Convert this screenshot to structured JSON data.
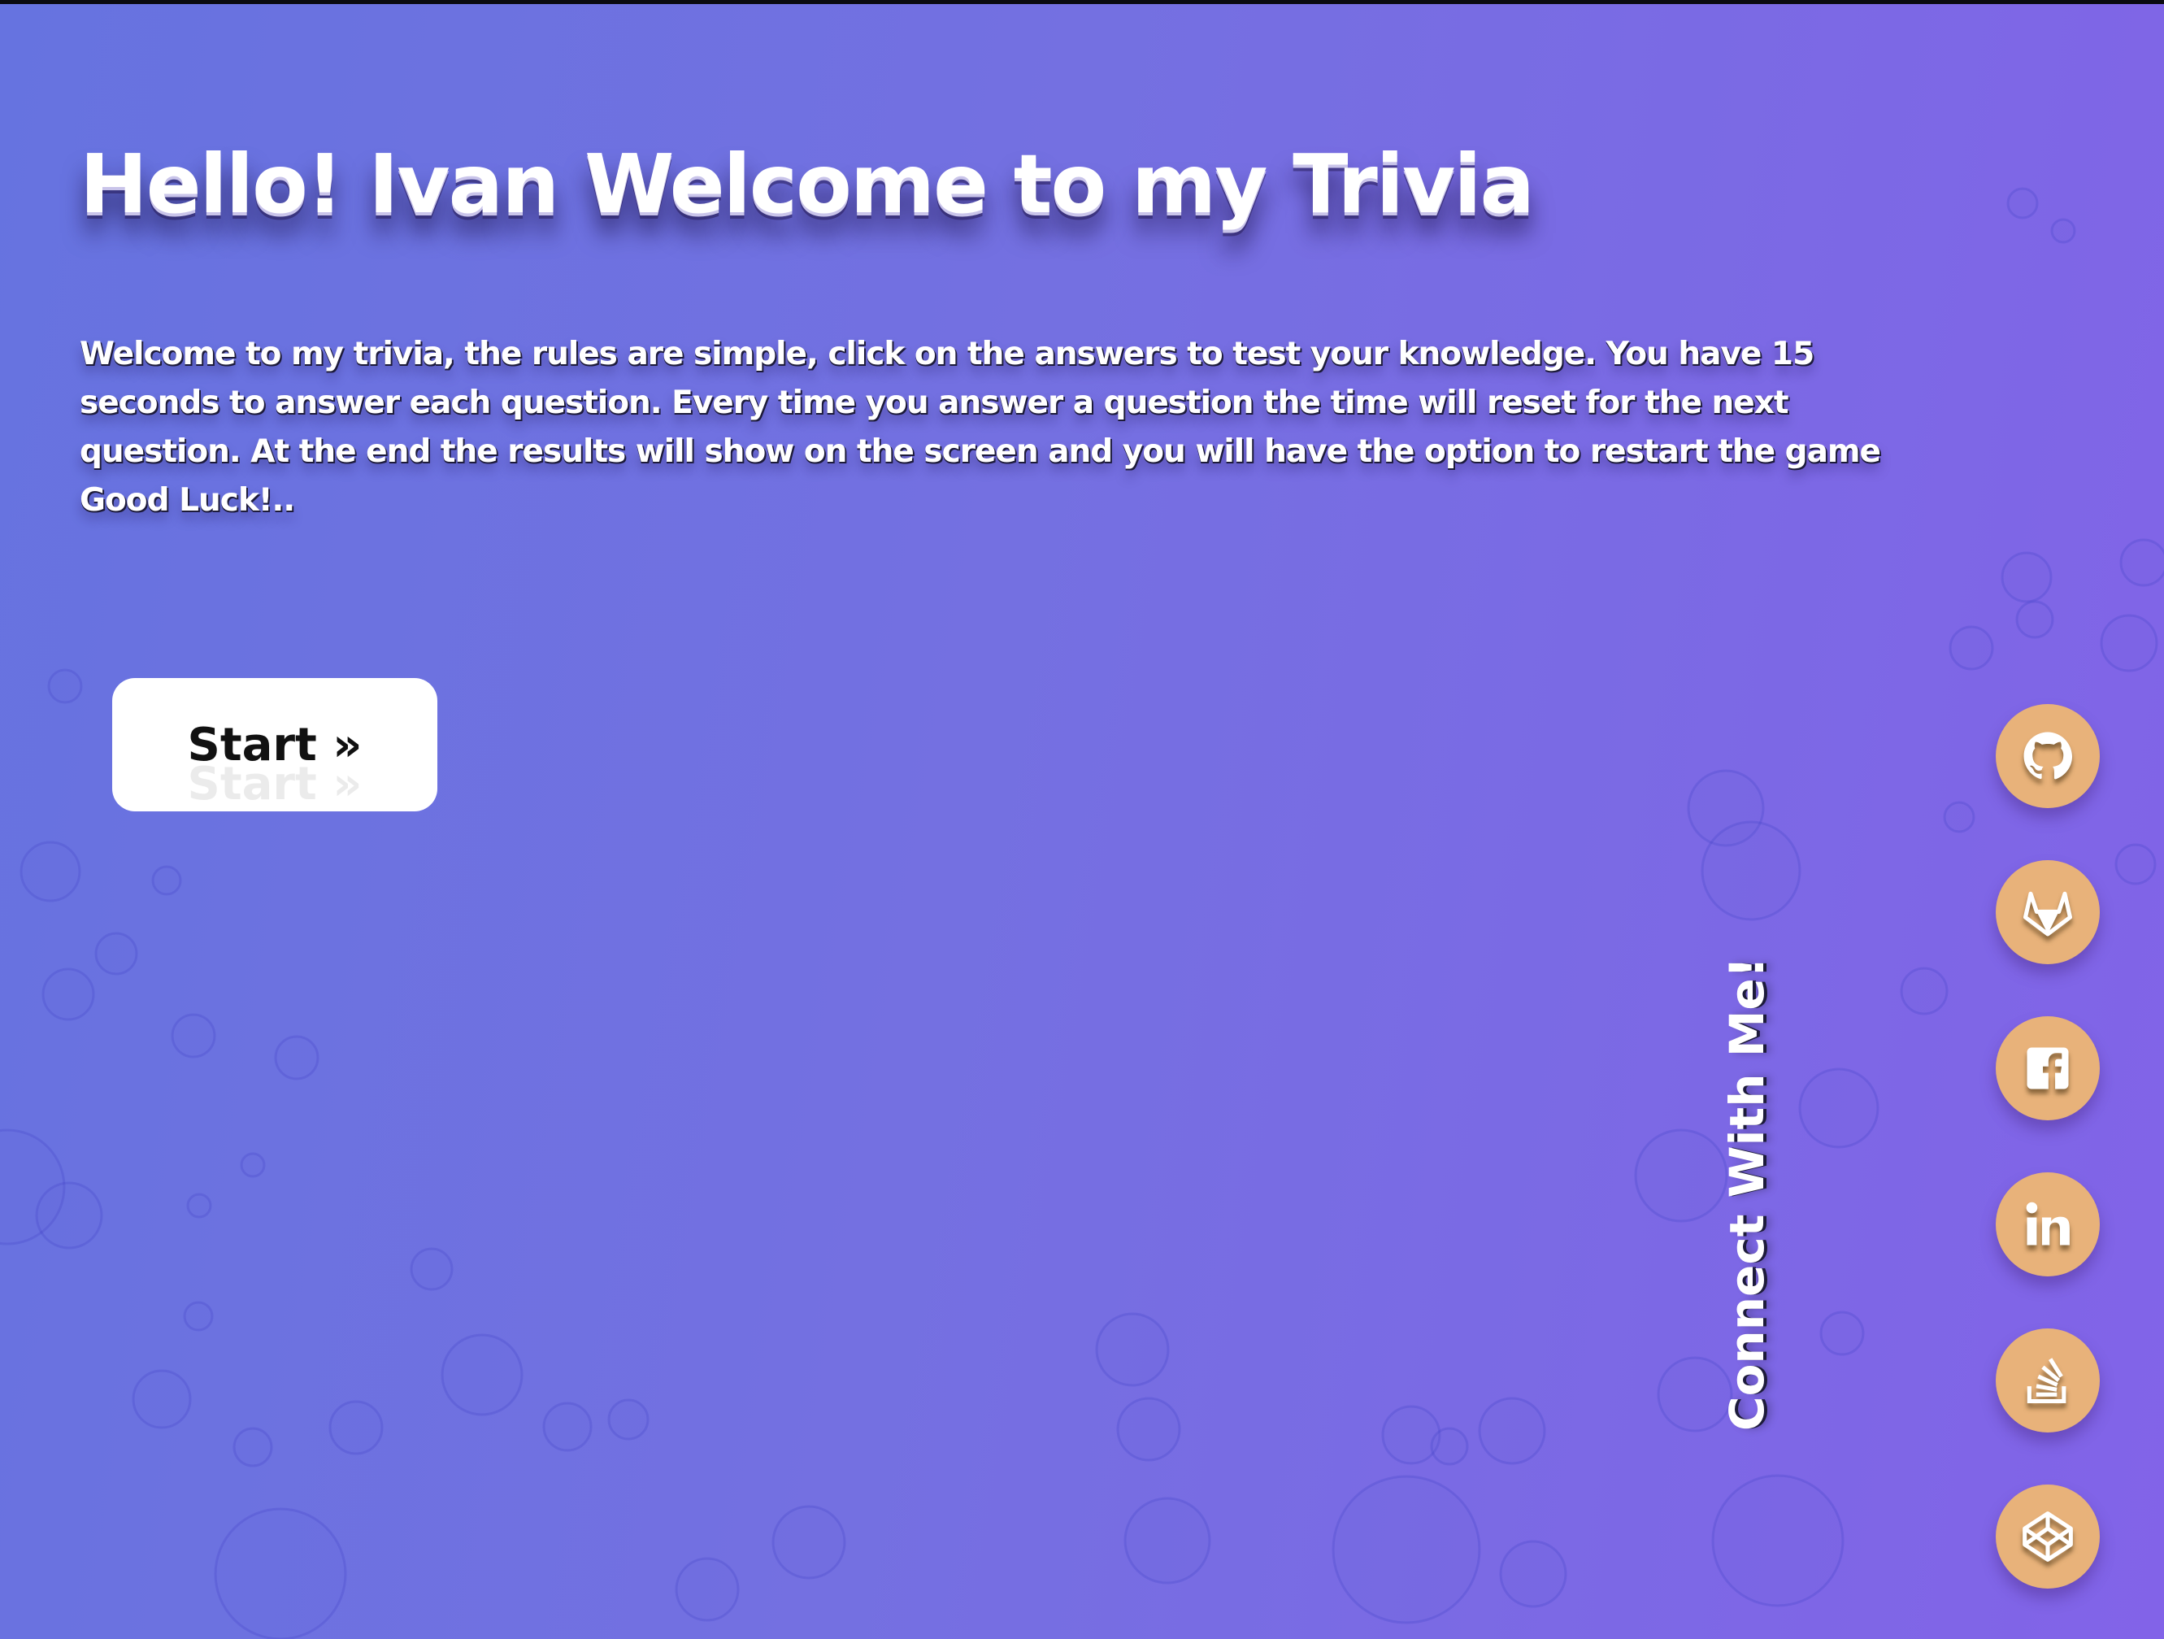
{
  "app": {
    "title": "Hello! Ivan Welcome to my Trivia",
    "rules": "Welcome to my trivia, the rules are simple, click on the answers to test your knowledge. You have 15 seconds to answer each question. Every time you answer a question the time will reset for the next question. At the end the results will show on the screen and you will have the option to restart the game Good Luck!..",
    "start_label": "Start »"
  },
  "social": {
    "heading": "Connect With Me!",
    "icons": [
      "github-icon",
      "gitlab-icon",
      "facebook-icon",
      "linkedin-icon",
      "stackoverflow-icon",
      "codepen-icon"
    ]
  },
  "colors": {
    "background_start": "#6673e0",
    "background_end": "#8263e8",
    "button_bg": "#ffffff",
    "social_circle": "#e8b27a",
    "text": "#ffffff"
  }
}
